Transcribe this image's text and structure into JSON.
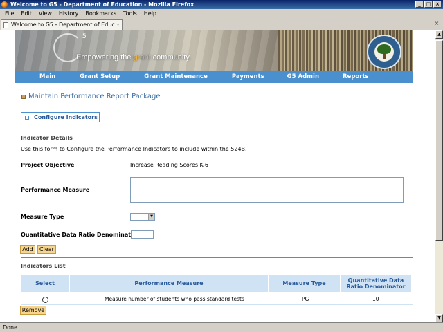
{
  "window": {
    "title": "Welcome to G5 - Department of Education - Mozilla Firefox",
    "controls": [
      "_",
      "□",
      "×"
    ]
  },
  "menu": [
    "File",
    "Edit",
    "View",
    "History",
    "Bookmarks",
    "Tools",
    "Help"
  ],
  "tabs": [
    {
      "label": "Welcome to G5 - Department of Educ...",
      "close": "-"
    }
  ],
  "tab_close_right": "×",
  "banner": {
    "logo_mark": "5",
    "tagline_before": "Empowering the ",
    "tagline_accent": "grant",
    "tagline_after": " community.",
    "colors": {
      "accent": "#f3b73b"
    }
  },
  "nav": [
    "Main",
    "Grant Setup",
    "Grant Maintenance",
    "Payments",
    "G5 Admin",
    "Reports"
  ],
  "page": {
    "title": "Maintain Performance Report Package",
    "section_tab": "Configure Indicators",
    "indicator_details_heading": "Indicator Details",
    "instructions": "Use this form to Configure the Performance Indicators to include within the 524B.",
    "project_objective_label": "Project Objective",
    "project_objective_value": "Increase Reading Scores K-6",
    "performance_measure_label": "Performance Measure",
    "performance_measure_value": "",
    "measure_type_label": "Measure Type",
    "measure_type_value": "",
    "denominator_label": "Quantitative Data Ratio Denominator",
    "denominator_value": "",
    "add_button": "Add",
    "clear_button": "Clear",
    "indicators_list_heading": "Indicators List",
    "table": {
      "headers": [
        "Select",
        "Performance Measure",
        "Measure Type",
        "Quantitative Data Ratio Denominator"
      ],
      "rows": [
        {
          "measure": "Measure number of students who pass standard tests",
          "type": "PG",
          "denominator": "10"
        }
      ]
    },
    "remove_button": "Remove"
  },
  "status": "Done"
}
